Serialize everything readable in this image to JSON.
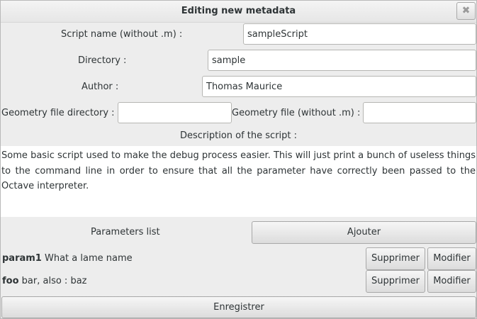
{
  "window": {
    "title": "Editing new metadata",
    "close_label": "✖"
  },
  "form": {
    "script_name_label": "Script name (without .m) :",
    "script_name_value": "sampleScript",
    "directory_label": "Directory :",
    "directory_value": "sample",
    "author_label": "Author :",
    "author_value": "Thomas Maurice",
    "geometry_dir_label": "Geometry file directory :",
    "geometry_dir_value": "",
    "geometry_file_label": "Geometry file (without .m) :",
    "geometry_file_value": "",
    "description_label": "Description of the script :",
    "description_value": "Some basic script used to make the debug process easier. This will just print a bunch of useless things to the command line in order to ensure that all the parameter have correctly been passed to the Octave interpreter."
  },
  "parameters": {
    "list_label": "Parameters list",
    "add_label": "Ajouter",
    "items": [
      {
        "name": "param1",
        "description": "What a lame name",
        "delete_label": "Supprimer",
        "edit_label": "Modifier"
      },
      {
        "name": "foo",
        "description": "bar, also : baz",
        "delete_label": "Supprimer",
        "edit_label": "Modifier"
      }
    ]
  },
  "footer": {
    "save_label": "Enregistrer"
  }
}
